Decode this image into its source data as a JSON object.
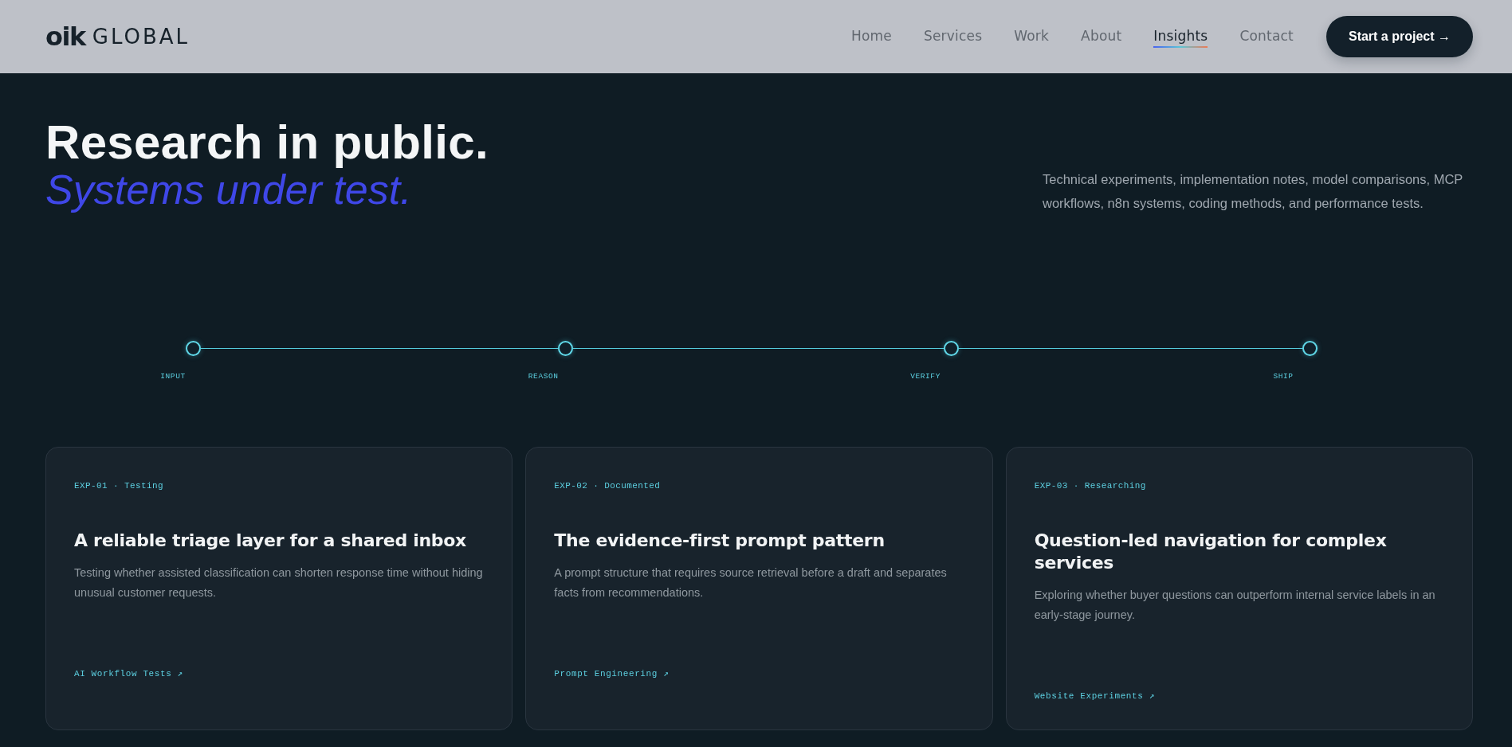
{
  "header": {
    "logo": {
      "mark": "oik",
      "name": "GLOBAL"
    },
    "nav": [
      {
        "label": "Home",
        "selected": false
      },
      {
        "label": "Services",
        "selected": false
      },
      {
        "label": "Work",
        "selected": false
      },
      {
        "label": "About",
        "selected": false
      },
      {
        "label": "Insights",
        "selected": true
      },
      {
        "label": "Contact",
        "selected": false
      }
    ],
    "cta": {
      "label": "Start a project →"
    }
  },
  "hero": {
    "title": "Research in public.",
    "subtitle": "Systems under test.",
    "description": "Technical experiments, implementation notes, model comparisons, MCP workflows, n8n systems, coding methods, and performance tests."
  },
  "pipeline": {
    "steps": [
      {
        "label": "INPUT"
      },
      {
        "label": "REASON"
      },
      {
        "label": "VERIFY"
      },
      {
        "label": "SHIP"
      }
    ]
  },
  "experiments": [
    {
      "tag": "EXP-01 · Testing",
      "title": "A reliable triage layer for a shared inbox",
      "description": "Testing whether assisted classification can shorten response time without hiding unusual customer requests.",
      "link": "AI Workflow Tests ↗"
    },
    {
      "tag": "EXP-02 · Documented",
      "title": "The evidence-first prompt pattern",
      "description": "A prompt structure that requires source retrieval before a draft and separates facts from recommendations.",
      "link": "Prompt Engineering ↗"
    },
    {
      "tag": "EXP-03 · Researching",
      "title": "Question-led navigation for complex services",
      "description": "Exploring whether buyer questions can outperform internal service labels in an early-stage journey.",
      "link": "Website Experiments ↗"
    }
  ]
}
